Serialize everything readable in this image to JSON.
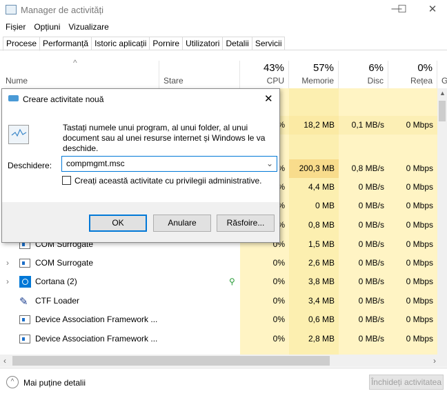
{
  "window": {
    "title": "Manager de activități",
    "minimize": "—",
    "maximize": "☐",
    "close": "✕"
  },
  "menu": [
    "Fișier",
    "Opțiuni",
    "Vizualizare"
  ],
  "tabs": [
    "Procese",
    "Performanță",
    "Istoric aplicații",
    "Pornire",
    "Utilizatori",
    "Detalii",
    "Servicii"
  ],
  "columns": {
    "name": "Nume",
    "status": "Stare",
    "cpu": {
      "pct": "43%",
      "label": "CPU"
    },
    "memory": {
      "pct": "57%",
      "label": "Memorie"
    },
    "disk": {
      "pct": "6%",
      "label": "Disc"
    },
    "network": {
      "pct": "0%",
      "label": "Rețea"
    },
    "extra": "G"
  },
  "rows": [
    {
      "cpu": "%",
      "mem": "18,2 MB",
      "disk": "0,1 MB/s",
      "net": "0 Mbps"
    },
    {
      "cpu": "%",
      "mem": "200,3 MB",
      "disk": "0,8 MB/s",
      "net": "0 Mbps"
    },
    {
      "cpu": "%",
      "mem": "4,4 MB",
      "disk": "0 MB/s",
      "net": "0 Mbps"
    },
    {
      "cpu": "%",
      "mem": "0 MB",
      "disk": "0 MB/s",
      "net": "0 Mbps"
    },
    {
      "cpu": "%",
      "mem": "0,8 MB",
      "disk": "0 MB/s",
      "net": "0 Mbps"
    },
    {
      "name": "COM Surrogate",
      "cpu": "0%",
      "mem": "1,5 MB",
      "disk": "0 MB/s",
      "net": "0 Mbps"
    },
    {
      "name": "COM Surrogate",
      "cpu": "0%",
      "mem": "2,6 MB",
      "disk": "0 MB/s",
      "net": "0 Mbps"
    },
    {
      "name": "Cortana (2)",
      "cpu": "0%",
      "mem": "3,8 MB",
      "disk": "0 MB/s",
      "net": "0 Mbps"
    },
    {
      "name": "CTF Loader",
      "cpu": "0%",
      "mem": "3,4 MB",
      "disk": "0 MB/s",
      "net": "0 Mbps"
    },
    {
      "name": "Device Association Framework ...",
      "cpu": "0%",
      "mem": "0,6 MB",
      "disk": "0 MB/s",
      "net": "0 Mbps"
    },
    {
      "name": "Device Association Framework ...",
      "cpu": "0%",
      "mem": "2,8 MB",
      "disk": "0 MB/s",
      "net": "0 Mbps"
    }
  ],
  "dialog": {
    "title": "Creare activitate nouă",
    "close": "✕",
    "description": "Tastați numele unui program, al unui folder, al unui document sau al unei resurse internet și Windows le va deschide.",
    "open_label": "Deschidere:",
    "open_value": "compmgmt.msc",
    "admin_checkbox": "Creați această activitate cu privilegii administrative.",
    "admin_checked": false,
    "ok": "OK",
    "cancel": "Anulare",
    "browse": "Răsfoire..."
  },
  "footer": {
    "fewer_details": "Mai puține detalii",
    "end_task": "Închideți activitatea"
  }
}
